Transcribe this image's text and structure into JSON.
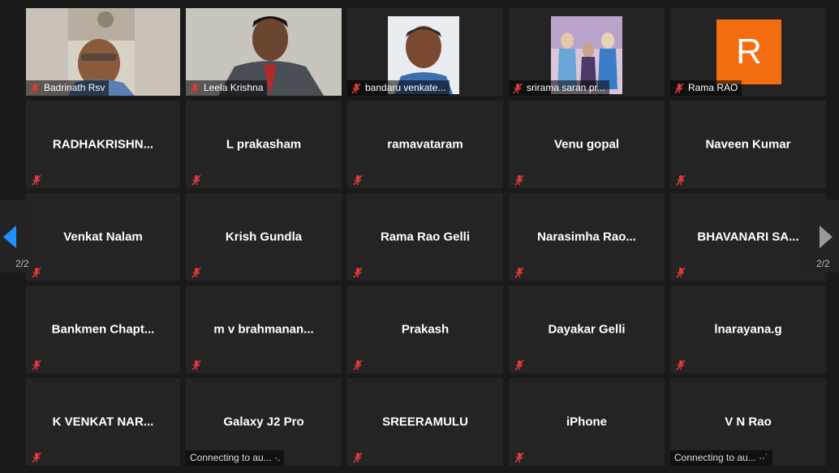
{
  "video_tiles": [
    {
      "name": "Badrinath Rsv"
    },
    {
      "name": "Leela Krishna"
    },
    {
      "name": "bandaru venkate..."
    },
    {
      "name": "srirama saran pr..."
    },
    {
      "name": "Rama RAO",
      "avatar_letter": "R",
      "avatar_color": "#f26d0f"
    }
  ],
  "rows": [
    [
      "RADHAKRISHN...",
      "L prakasham",
      "ramavataram",
      "Venu gopal",
      "Naveen Kumar"
    ],
    [
      "Venkat Nalam",
      "Krish Gundla",
      "Rama Rao Gelli",
      "Narasimha  Rao...",
      "BHAVANARI SA..."
    ],
    [
      "Bankmen  Chapt...",
      "m  v  brahmanan...",
      "Prakash",
      "Dayakar Gelli",
      "lnarayana.g"
    ],
    [
      "K VENKAT NAR...",
      "Galaxy J2 Pro",
      "SREERAMULU",
      "iPhone",
      "V N Rao"
    ]
  ],
  "status_messages": {
    "galaxy": "Connecting to au...  ·.",
    "vnrao": "Connecting to au...  ··˙"
  },
  "pagination": {
    "left": "2/2",
    "right": "2/2"
  },
  "colors": {
    "background": "#1a1a1a",
    "tile": "#242424",
    "muted_icon": "#e23b3b",
    "prev_arrow": "#1e90ff",
    "next_arrow": "#9a9a9a"
  }
}
